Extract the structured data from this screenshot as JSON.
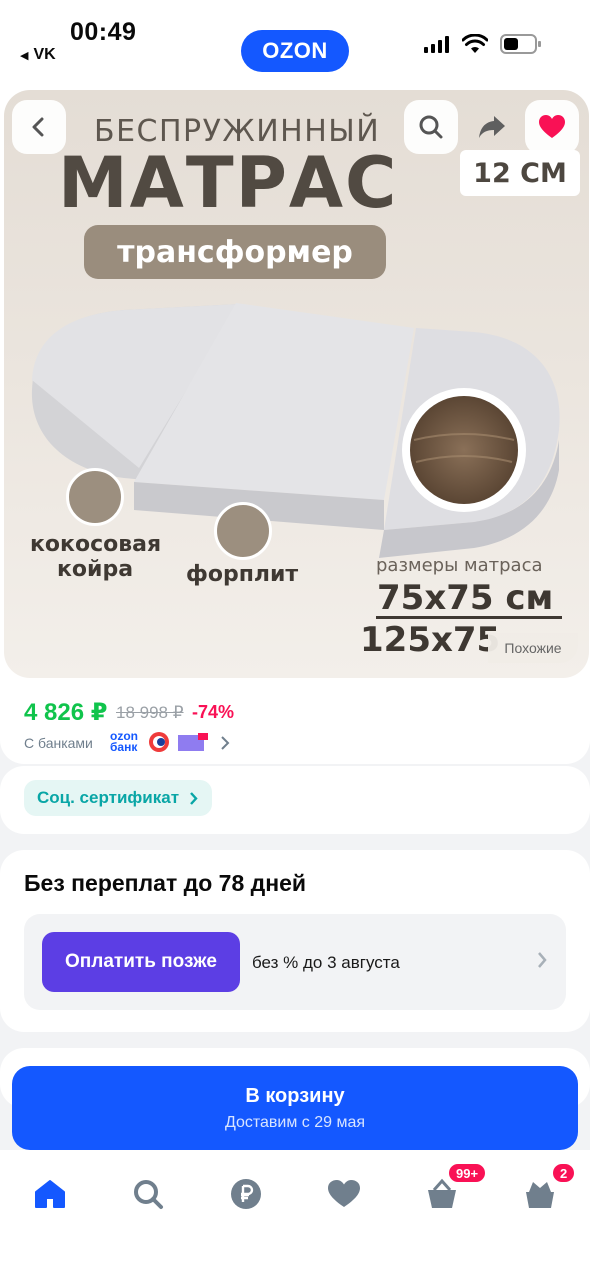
{
  "status_bar": {
    "time": "00:49",
    "back_app": "VK"
  },
  "brand": {
    "logo": "OZON",
    "color": "#1458ff"
  },
  "image_overlay": {
    "back_icon": "chevron-left-icon",
    "search_icon": "search-icon",
    "share_icon": "share-icon",
    "favorite_icon": "heart-icon",
    "similar_label": "Похожие"
  },
  "product_image": {
    "headline_small": "БЕСПРУЖИННЫЙ",
    "headline_big": "МАТРАС",
    "pill": "трансформер",
    "thickness": "12 СМ",
    "feature_1": [
      "кокосовая",
      "койра"
    ],
    "feature_2": "форплит",
    "sizes_heading": "размеры матраса",
    "size_1": "75х75 см",
    "size_2": "125х75"
  },
  "price": {
    "current": "4 826 ₽",
    "old": "18 998 ₽",
    "discount": "-74%",
    "banks_label": "С банками",
    "ozon_bank": [
      "ozon",
      "банк"
    ]
  },
  "certificate": {
    "label": "Соц. сертификат"
  },
  "pay_later": {
    "title": "Без переплат до 78 дней",
    "button": "Оплатить позже",
    "description": "без % до 3 августа"
  },
  "cart": {
    "button": "В корзину",
    "delivery": "Доставим с 29 мая"
  },
  "tabbar": {
    "items": [
      "home-icon",
      "search-icon",
      "ruble-icon",
      "heart-icon",
      "cart-icon",
      "profile-icon"
    ],
    "cart_badge": "99+",
    "profile_badge": "2",
    "active_color": "#1458ff"
  }
}
